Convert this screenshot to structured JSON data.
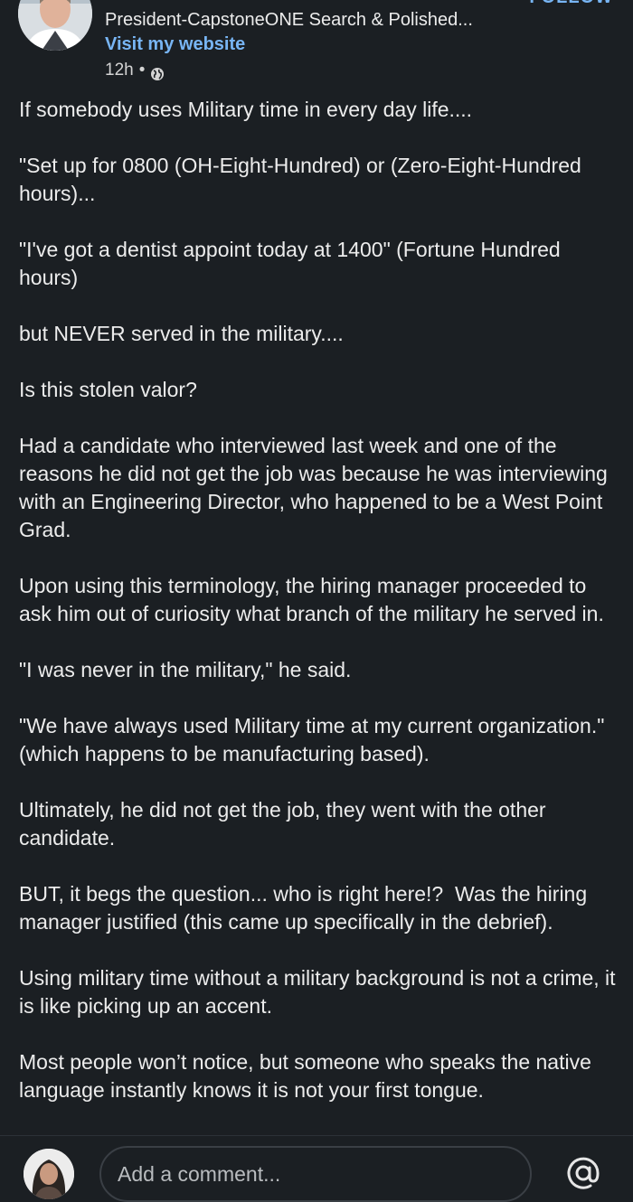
{
  "post": {
    "author_headline": "President-CapstoneONE Search & Polished...",
    "website_link": "Visit my website",
    "time": "12h",
    "separator": "•",
    "follow_fragment": "FOLLOW",
    "paragraphs": [
      "If somebody uses Military time in every day life....",
      "\"Set up for 0800 (OH-Eight-Hundred) or (Zero-Eight-Hundred hours)...",
      "\"I've got a dentist appoint today at 1400\" (Fortune Hundred hours)",
      "but NEVER served in the military....",
      "Is this stolen valor?",
      "Had a candidate who interviewed last week and one of the reasons he did not get the job was because he was interviewing with an Engineering Director, who happened to be a West Point Grad.",
      "Upon using this terminology, the hiring manager proceeded to ask him out of curiosity what branch of the military he served in.",
      "\"I was never in the military,\" he said.",
      "\"We have always used Military time at my current organization.\"  (which happens to be manufacturing based).",
      "Ultimately, he did not get the job, they went with the other candidate.",
      "BUT, it begs the question... who is right here!?  Was the hiring manager justified (this came up specifically in the debrief).",
      "Using military time without a military background is not a crime, it is like picking up an accent.",
      "Most people won’t notice, but someone who speaks the native language instantly knows it is not your first tongue."
    ]
  },
  "comment": {
    "placeholder": "Add a comment...",
    "mention_icon": "at-icon"
  },
  "icons": {
    "globe": "globe-icon",
    "author_avatar": "avatar",
    "user_avatar": "avatar"
  },
  "colors": {
    "background": "#1b1f23",
    "text": "#ececec",
    "link": "#78b5f4"
  }
}
